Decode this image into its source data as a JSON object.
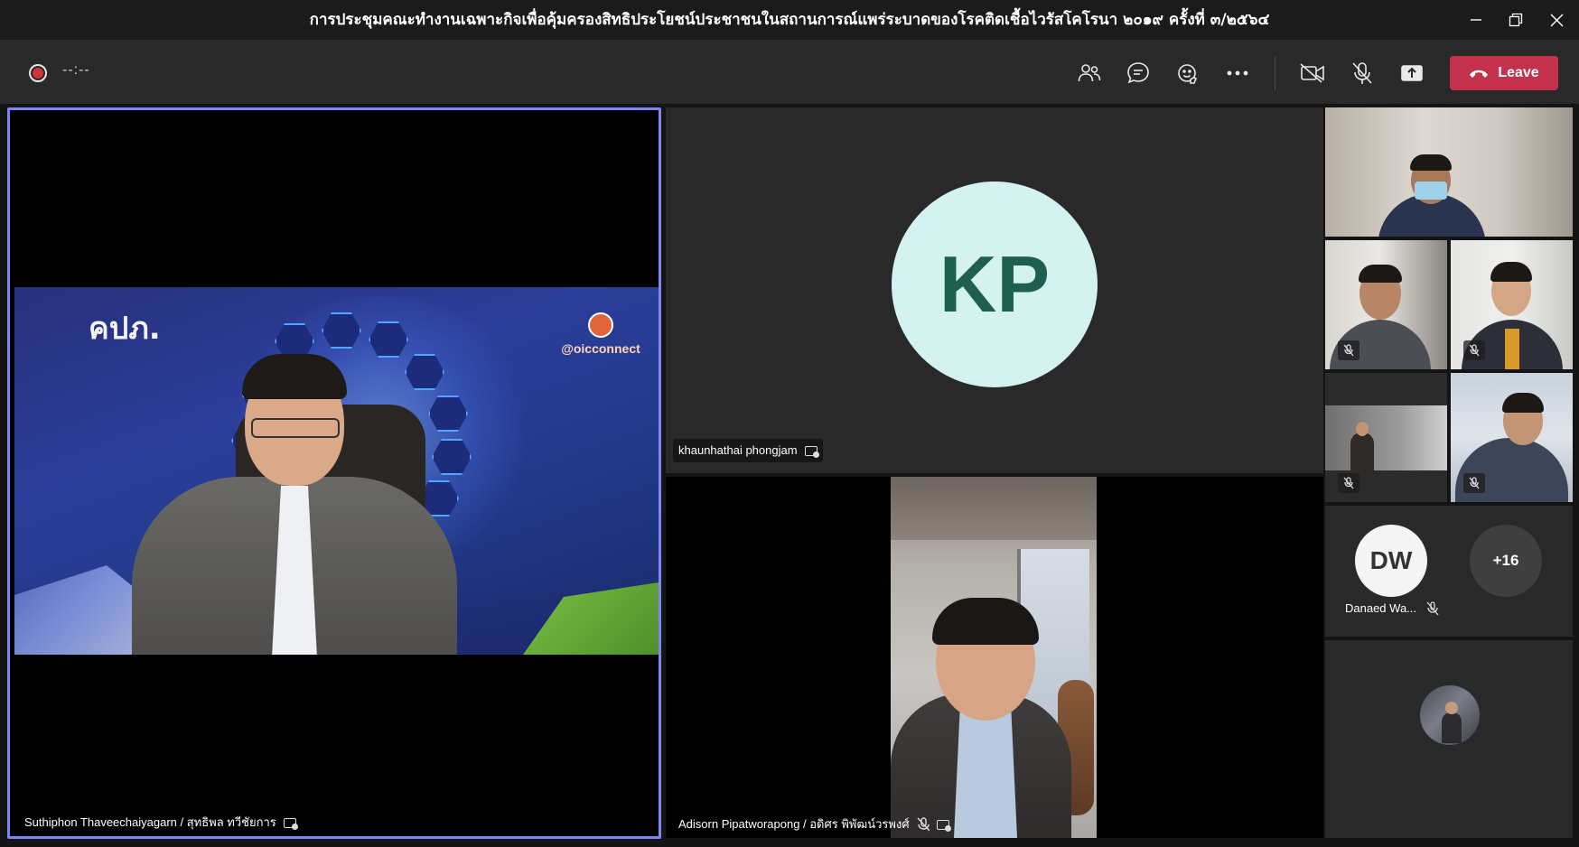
{
  "window": {
    "title": "การประชุมคณะทำงานเฉพาะกิจเพื่อคุ้มครองสิทธิประโยชน์ประชาชนในสถานการณ์แพร่ระบาดของโรคติดเชื้อไวรัสโคโรนา ๒๐๑๙ ครั้งที่ ๓/๒๕๖๔"
  },
  "toolbar": {
    "timer": "--:--",
    "leave_label": "Leave",
    "accent_color": "#c4314b",
    "buttons": [
      "people-icon",
      "chat-icon",
      "reactions-icon",
      "more-icon",
      "camera-off-icon",
      "mic-off-icon",
      "share-tray-icon"
    ]
  },
  "participants": {
    "main": {
      "name": "Suthiphon Thaveechaiyagarn / สุทธิพล ทวีชัยการ",
      "background_logo_left": "คปภ.",
      "background_logo_right": "@oicconnect",
      "highlight_color": "#7f85f5"
    },
    "kp": {
      "initials": "KP",
      "name": "khaunhathai phongjam"
    },
    "adisorn": {
      "name": "Adisorn Pipatworapong / อดิศร พิพัฒน์วรพงศ์"
    },
    "dw": {
      "initials": "DW",
      "name": "Danaed Wa..."
    },
    "overflow": {
      "label": "+16"
    }
  }
}
